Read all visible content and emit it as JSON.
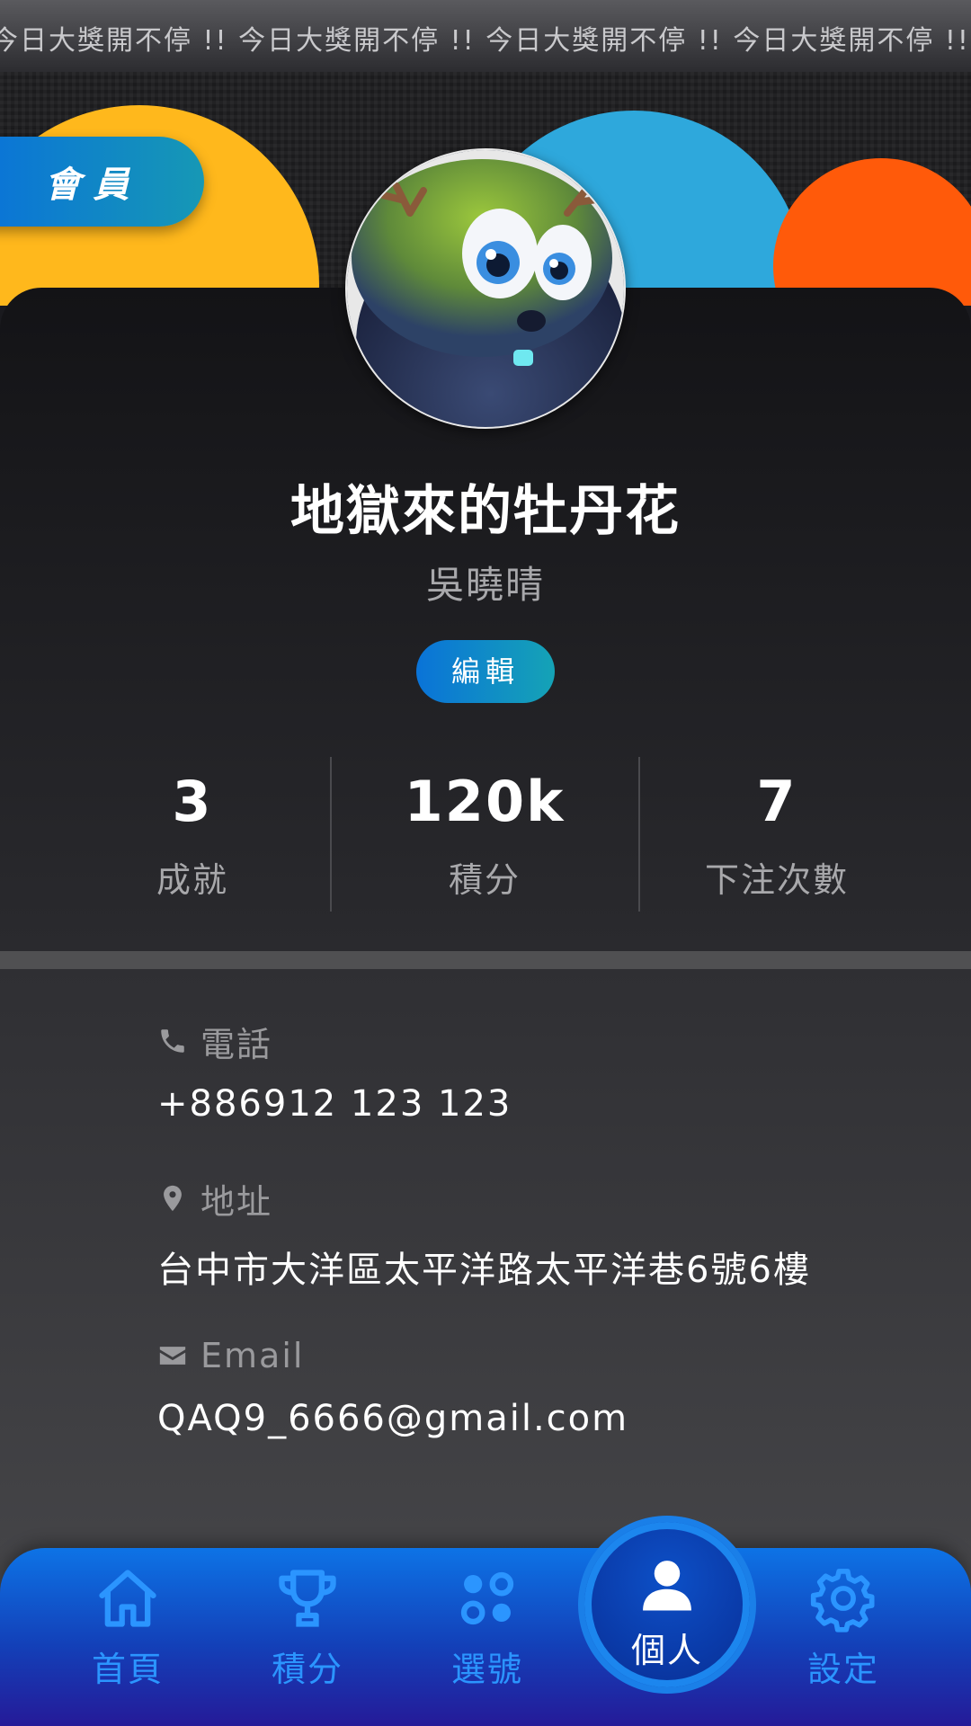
{
  "marquee": {
    "text": "今日大獎開不停 !! 今日大獎開不停 !! 今日大獎開不停 !! 今日大獎開不停 !! 今"
  },
  "member_tag": "會員",
  "profile": {
    "nickname": "地獄來的牡丹花",
    "real_name": "吳曉晴",
    "edit_label": "編輯"
  },
  "stats": [
    {
      "value": "3",
      "label": "成就"
    },
    {
      "value": "120k",
      "label": "積分"
    },
    {
      "value": "7",
      "label": "下注次數"
    }
  ],
  "info": {
    "phone": {
      "label": "電話",
      "value": "+886912  123  123"
    },
    "address": {
      "label": "地址",
      "value": "台中市大洋區太平洋路太平洋巷6號6樓"
    },
    "email": {
      "label": "Email",
      "value": "QAQ9_6666@gmail.com"
    }
  },
  "nav": [
    {
      "label": "首頁",
      "icon": "home-icon"
    },
    {
      "label": "積分",
      "icon": "trophy-icon"
    },
    {
      "label": "選號",
      "icon": "dots-grid-icon"
    },
    {
      "label": "個人",
      "icon": "user-icon",
      "active": true
    },
    {
      "label": "設定",
      "icon": "gear-icon"
    }
  ],
  "colors": {
    "accent_blue": "#0a73d8",
    "yellow": "#ffb81c",
    "sky_blue": "#2ea8dc",
    "orange": "#ff5a0a"
  }
}
